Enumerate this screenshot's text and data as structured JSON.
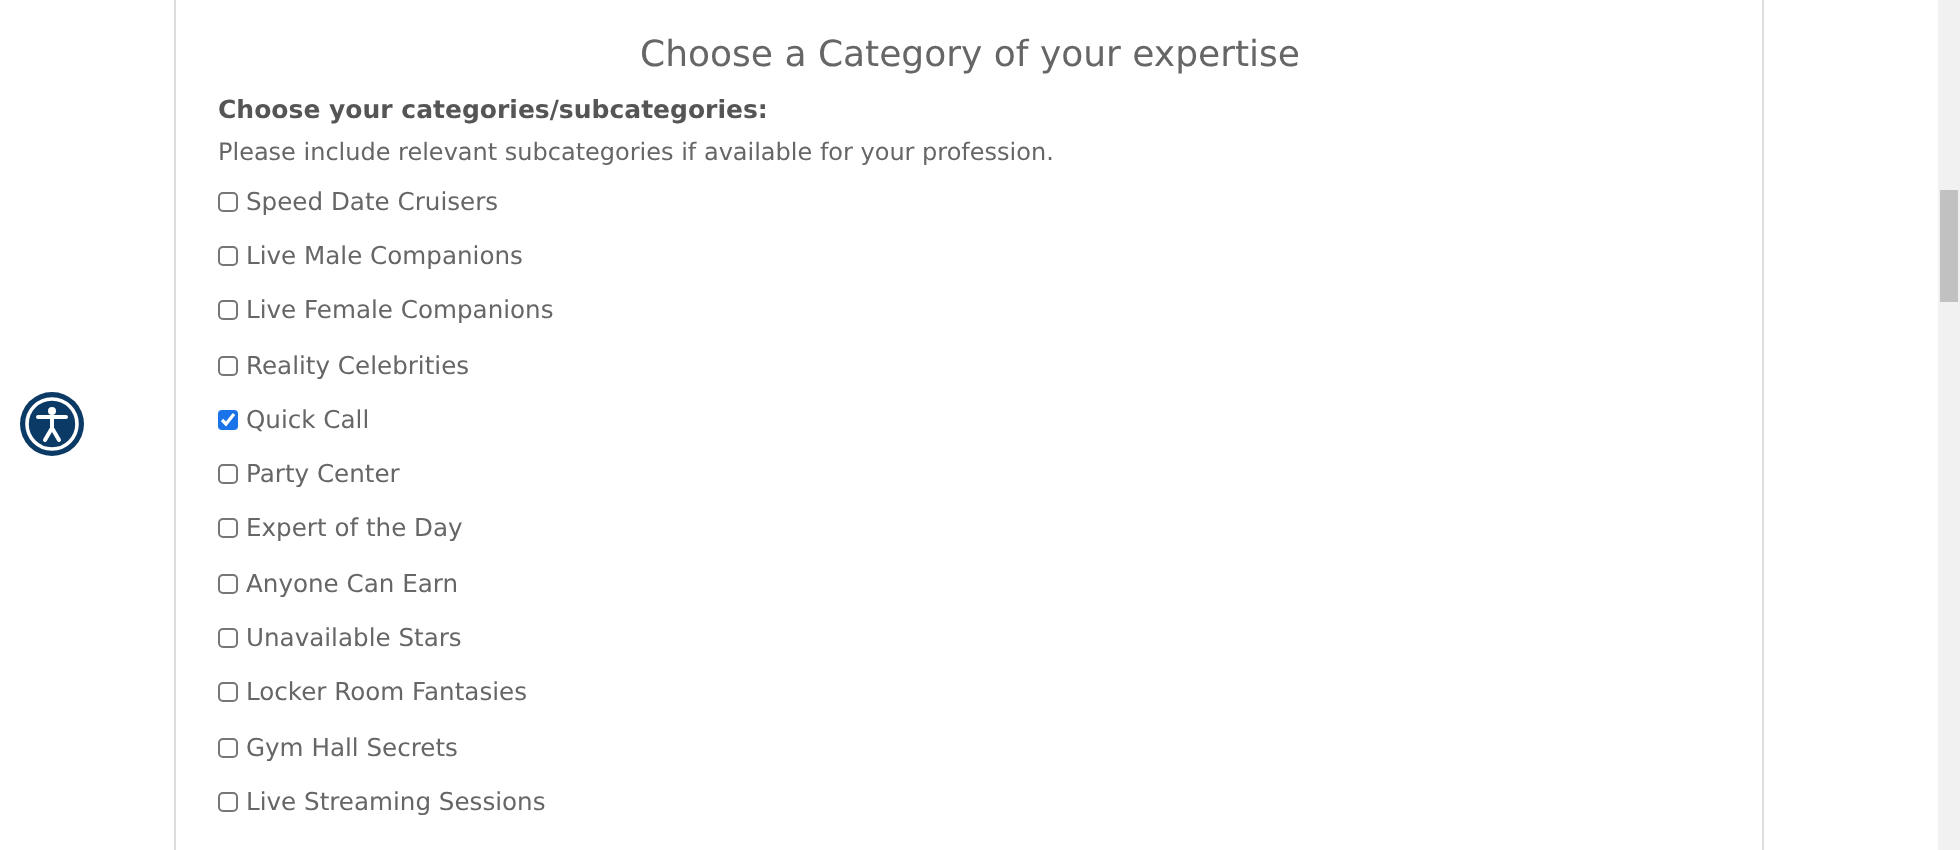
{
  "form": {
    "title": "Choose a Category of your expertise",
    "heading": "Choose your categories/subcategories:",
    "hint": "Please include relevant subcategories if available for your profession.",
    "categories": [
      {
        "label": "Speed Date Cruisers",
        "checked": false
      },
      {
        "label": "Live Male Companions",
        "checked": false
      },
      {
        "label": "Live Female Companions",
        "checked": false
      },
      {
        "label": "Reality Celebrities",
        "checked": false
      },
      {
        "label": "Quick Call",
        "checked": true
      },
      {
        "label": "Party Center",
        "checked": false
      },
      {
        "label": "Expert of the Day",
        "checked": false
      },
      {
        "label": "Anyone Can Earn",
        "checked": false
      },
      {
        "label": "Unavailable Stars",
        "checked": false
      },
      {
        "label": "Locker Room Fantasies",
        "checked": false
      },
      {
        "label": "Gym Hall Secrets",
        "checked": false
      },
      {
        "label": "Live Streaming Sessions",
        "checked": false
      }
    ]
  }
}
